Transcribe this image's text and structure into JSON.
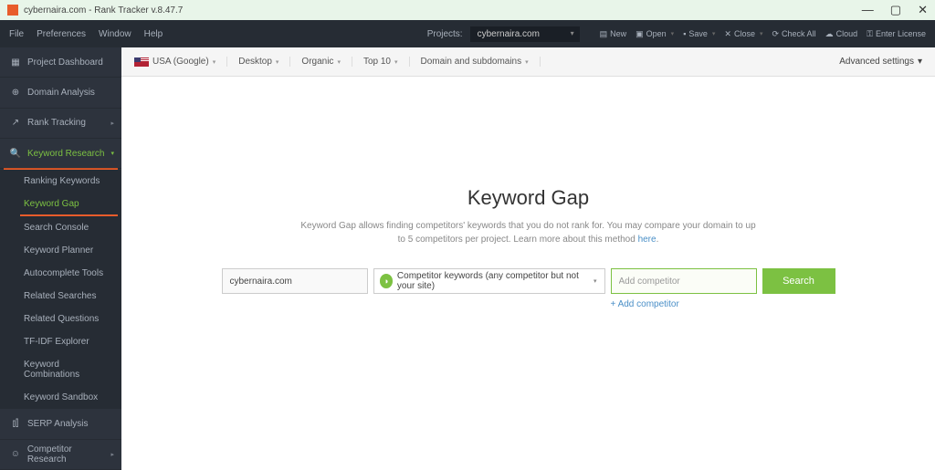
{
  "window": {
    "title": "cybernaira.com - Rank Tracker v.8.47.7",
    "controls": {
      "min": "—",
      "max": "▢",
      "close": "✕"
    }
  },
  "menubar": {
    "items": [
      "File",
      "Preferences",
      "Window",
      "Help"
    ],
    "projects_label": "Projects:",
    "project_selected": "cybernaira.com",
    "tools": {
      "new": "New",
      "open": "Open",
      "save": "Save",
      "close": "Close",
      "check_all": "Check All",
      "cloud": "Cloud",
      "enter_license": "Enter License"
    }
  },
  "sidebar": {
    "dashboard": "Project Dashboard",
    "domain_analysis": "Domain Analysis",
    "rank_tracking": "Rank Tracking",
    "keyword_research": "Keyword Research",
    "kr_sub": {
      "ranking_keywords": "Ranking Keywords",
      "keyword_gap": "Keyword Gap",
      "search_console": "Search Console",
      "keyword_planner": "Keyword Planner",
      "autocomplete": "Autocomplete Tools",
      "related_searches": "Related Searches",
      "related_questions": "Related Questions",
      "tfidf": "TF-IDF Explorer",
      "combinations": "Keyword Combinations",
      "sandbox": "Keyword Sandbox"
    },
    "serp_analysis": "SERP Analysis",
    "competitor_research": "Competitor Research"
  },
  "filterbar": {
    "country": "USA (Google)",
    "device": "Desktop",
    "traffic": "Organic",
    "topn": "Top 10",
    "scope": "Domain and subdomains",
    "advanced": "Advanced settings"
  },
  "page": {
    "title": "Keyword Gap",
    "desc_prefix": "Keyword Gap allows finding competitors' keywords that you do not rank for. You may compare your domain to up to 5 competitors per project. Learn more about this method ",
    "desc_link": "here",
    "your_site_value": "cybernaira.com",
    "method_label": "Competitor keywords (any competitor but not your site)",
    "competitor_placeholder": "Add competitor",
    "add_competitor": "+ Add competitor",
    "search_btn": "Search"
  }
}
